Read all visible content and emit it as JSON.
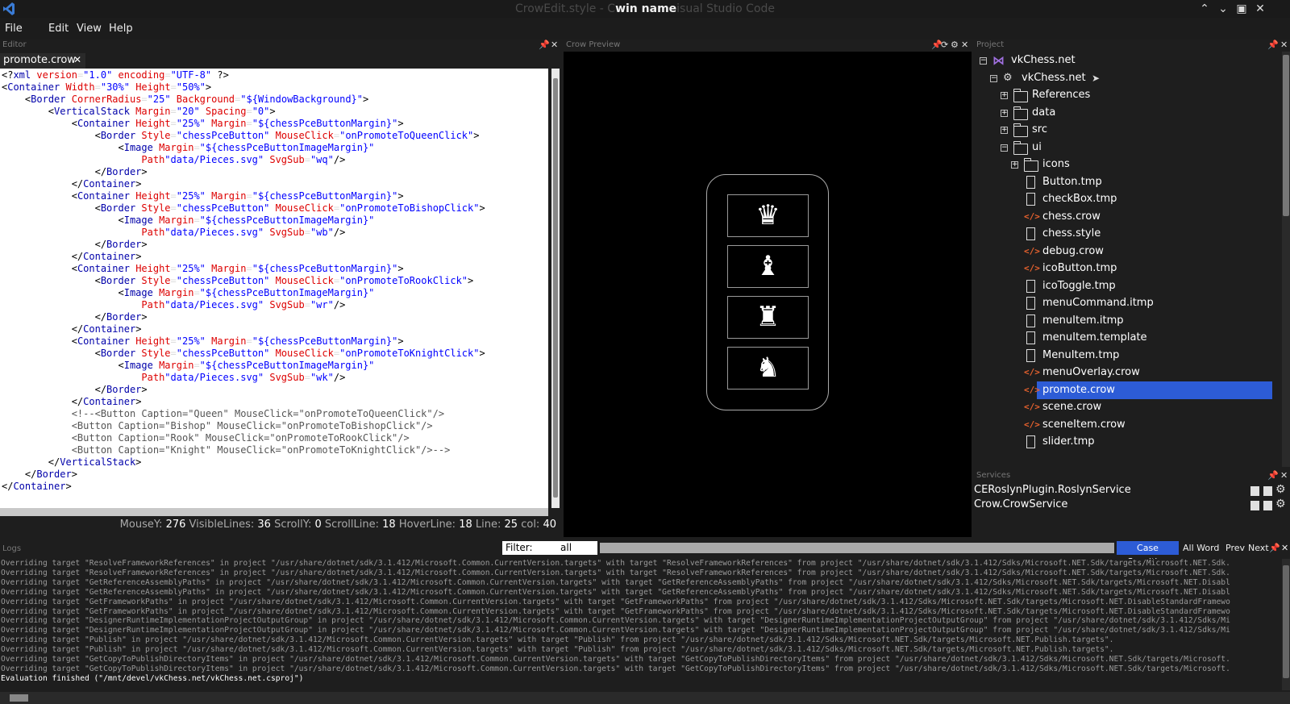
{
  "window": {
    "title_prefix": "CrowEdit.style - C",
    "title_bold": "win name",
    "title_suffix": "isual Studio Code",
    "minimize": "⌃",
    "maximize": "⌄",
    "restore": "▣",
    "close": "✕"
  },
  "menu": {
    "file": "File",
    "edit": "Edit",
    "view": "View",
    "help": "Help"
  },
  "panels": {
    "editor": "Editor",
    "preview": "Crow Preview",
    "project": "Project",
    "services": "Services",
    "logs": "Logs"
  },
  "editor": {
    "tab_label": "promote.crow",
    "tab_close": "✕",
    "lines": [
      "<?xml version=\"1.0\" encoding=\"UTF-8\" ?>",
      "<Container Width=\"30%\" Height=\"50%\">",
      "    <Border CornerRadius=\"25\" Background=\"${WindowBackground}\">",
      "        <VerticalStack Margin=\"20\" Spacing=\"0\">",
      "            <Container Height=\"25%\" Margin=\"${chessPceButtonMargin}\">",
      "                <Border Style=\"chessPceButton\" MouseClick=\"onPromoteToQueenClick\">",
      "                    <Image Margin=\"${chessPceButtonImageMargin}\"",
      "                        Path=\"data/Pieces.svg\" SvgSub=\"wq\"/>",
      "                </Border>",
      "            </Container>",
      "            <Container Height=\"25%\" Margin=\"${chessPceButtonMargin}\">",
      "                <Border Style=\"chessPceButton\" MouseClick=\"onPromoteToBishopClick\">",
      "                    <Image Margin=\"${chessPceButtonImageMargin}\"",
      "                        Path=\"data/Pieces.svg\" SvgSub=\"wb\"/>",
      "                </Border>",
      "            </Container>",
      "            <Container Height=\"25%\" Margin=\"${chessPceButtonMargin}\">",
      "                <Border Style=\"chessPceButton\" MouseClick=\"onPromoteToRookClick\">",
      "                    <Image Margin=\"${chessPceButtonImageMargin}\"",
      "                        Path=\"data/Pieces.svg\" SvgSub=\"wr\"/>",
      "                </Border>",
      "            </Container>",
      "            <Container Height=\"25%\" Margin=\"${chessPceButtonMargin}\">",
      "                <Border Style=\"chessPceButton\" MouseClick=\"onPromoteToKnightClick\">",
      "                    <Image Margin=\"${chessPceButtonImageMargin}\"",
      "                        Path=\"data/Pieces.svg\" SvgSub=\"wk\"/>",
      "                </Border>",
      "            </Container>",
      "            <!--<Button Caption=\"Queen\" MouseClick=\"onPromoteToQueenClick\"/>",
      "            <Button Caption=\"Bishop\" MouseClick=\"onPromoteToBishopClick\"/>",
      "            <Button Caption=\"Rook\" MouseClick=\"onPromoteToRookClick\"/>",
      "            <Button Caption=\"Knight\" MouseClick=\"onPromoteToKnightClick\"/>-->",
      "        </VerticalStack>",
      "    </Border>",
      "</Container>"
    ],
    "status": {
      "mousey_label": "MouseY:",
      "mousey": "276",
      "visible_label": "VisibleLines:",
      "visible": "36",
      "scrolly_label": "ScrollY:",
      "scrolly": "0",
      "scrollline_label": "ScrollLine:",
      "scrollline": "18",
      "hoverline_label": "HoverLine:",
      "hoverline": "18",
      "line_label": "Line:",
      "line": "25",
      "col_label": "col:",
      "col": "40"
    }
  },
  "preview": {
    "pieces": [
      "♛",
      "♝",
      "♜",
      "♞"
    ],
    "piece_names": [
      "queen",
      "bishop",
      "rook",
      "knight"
    ]
  },
  "project": {
    "nodes": [
      {
        "label": "vkChess.net",
        "kind": "solution",
        "depth": 0,
        "expander": "-"
      },
      {
        "label": "vkChess.net",
        "kind": "csproj",
        "depth": 1,
        "expander": "-"
      },
      {
        "label": "References",
        "kind": "folder",
        "depth": 2,
        "expander": "+"
      },
      {
        "label": "data",
        "kind": "folder",
        "depth": 2,
        "expander": "+"
      },
      {
        "label": "src",
        "kind": "folder",
        "depth": 2,
        "expander": "+"
      },
      {
        "label": "ui",
        "kind": "folder-open",
        "depth": 2,
        "expander": "-"
      },
      {
        "label": "icons",
        "kind": "folder",
        "depth": 3,
        "expander": "+"
      },
      {
        "label": "Button.tmp",
        "kind": "file",
        "depth": 3
      },
      {
        "label": "checkBox.tmp",
        "kind": "file",
        "depth": 3
      },
      {
        "label": "chess.crow",
        "kind": "crow",
        "depth": 3
      },
      {
        "label": "chess.style",
        "kind": "file",
        "depth": 3
      },
      {
        "label": "debug.crow",
        "kind": "crow",
        "depth": 3
      },
      {
        "label": "icoButton.tmp",
        "kind": "crow",
        "depth": 3
      },
      {
        "label": "icoToggle.tmp",
        "kind": "file",
        "depth": 3
      },
      {
        "label": "menuCommand.itmp",
        "kind": "file",
        "depth": 3
      },
      {
        "label": "menuItem.itmp",
        "kind": "file",
        "depth": 3
      },
      {
        "label": "menuItem.template",
        "kind": "file",
        "depth": 3
      },
      {
        "label": "MenuItem.tmp",
        "kind": "file",
        "depth": 3
      },
      {
        "label": "menuOverlay.crow",
        "kind": "crow",
        "depth": 3
      },
      {
        "label": "promote.crow",
        "kind": "crow",
        "depth": 3,
        "selected": true
      },
      {
        "label": "scene.crow",
        "kind": "crow",
        "depth": 3
      },
      {
        "label": "sceneItem.crow",
        "kind": "crow",
        "depth": 3
      },
      {
        "label": "slider.tmp",
        "kind": "file",
        "depth": 3
      }
    ]
  },
  "services": [
    {
      "name": "CERoslynPlugin.RoslynService"
    },
    {
      "name": "Crow.CrowService"
    }
  ],
  "logs": {
    "filter_label": "Filter:",
    "filter_value": "all",
    "case_sensitive": "Case Sensitive",
    "all_word": "All Word",
    "prev": "Prev",
    "next": "Next",
    "lines": [
      "Overriding target \"ResolveFrameworkReferences\" in project \"/usr/share/dotnet/sdk/3.1.412/Microsoft.Common.CurrentVersion.targets\" with target \"ResolveFrameworkReferences\" from project \"/usr/share/dotnet/sdk/3.1.412/Sdks/Microsoft.NET.Sdk/targets/Microsoft.NET.Sdk.",
      "Overriding target \"ResolveFrameworkReferences\" in project \"/usr/share/dotnet/sdk/3.1.412/Microsoft.Common.CurrentVersion.targets\" with target \"ResolveFrameworkReferences\" from project \"/usr/share/dotnet/sdk/3.1.412/Sdks/Microsoft.NET.Sdk/targets/Microsoft.NET.Sdk.",
      "Overriding target \"GetReferenceAssemblyPaths\" in project \"/usr/share/dotnet/sdk/3.1.412/Microsoft.Common.CurrentVersion.targets\" with target \"GetReferenceAssemblyPaths\" from project \"/usr/share/dotnet/sdk/3.1.412/Sdks/Microsoft.NET.Sdk/targets/Microsoft.NET.Disabl",
      "Overriding target \"GetReferenceAssemblyPaths\" in project \"/usr/share/dotnet/sdk/3.1.412/Microsoft.Common.CurrentVersion.targets\" with target \"GetReferenceAssemblyPaths\" from project \"/usr/share/dotnet/sdk/3.1.412/Sdks/Microsoft.NET.Sdk/targets/Microsoft.NET.Disabl",
      "Overriding target \"GetFrameworkPaths\" in project \"/usr/share/dotnet/sdk/3.1.412/Microsoft.Common.CurrentVersion.targets\" with target \"GetFrameworkPaths\" from project \"/usr/share/dotnet/sdk/3.1.412/Sdks/Microsoft.NET.Sdk/targets/Microsoft.NET.DisableStandardFramewo",
      "Overriding target \"GetFrameworkPaths\" in project \"/usr/share/dotnet/sdk/3.1.412/Microsoft.Common.CurrentVersion.targets\" with target \"GetFrameworkPaths\" from project \"/usr/share/dotnet/sdk/3.1.412/Sdks/Microsoft.NET.Sdk/targets/Microsoft.NET.DisableStandardFramewo",
      "Overriding target \"DesignerRuntimeImplementationProjectOutputGroup\" in project \"/usr/share/dotnet/sdk/3.1.412/Microsoft.Common.CurrentVersion.targets\" with target \"DesignerRuntimeImplementationProjectOutputGroup\" from project \"/usr/share/dotnet/sdk/3.1.412/Sdks/Mi",
      "Overriding target \"DesignerRuntimeImplementationProjectOutputGroup\" in project \"/usr/share/dotnet/sdk/3.1.412/Microsoft.Common.CurrentVersion.targets\" with target \"DesignerRuntimeImplementationProjectOutputGroup\" from project \"/usr/share/dotnet/sdk/3.1.412/Sdks/Mi",
      "Overriding target \"Publish\" in project \"/usr/share/dotnet/sdk/3.1.412/Microsoft.Common.CurrentVersion.targets\" with target \"Publish\" from project \"/usr/share/dotnet/sdk/3.1.412/Sdks/Microsoft.NET.Sdk/targets/Microsoft.NET.Publish.targets\".",
      "Overriding target \"Publish\" in project \"/usr/share/dotnet/sdk/3.1.412/Microsoft.Common.CurrentVersion.targets\" with target \"Publish\" from project \"/usr/share/dotnet/sdk/3.1.412/Sdks/Microsoft.NET.Sdk/targets/Microsoft.NET.Publish.targets\".",
      "Overriding target \"GetCopyToPublishDirectoryItems\" in project \"/usr/share/dotnet/sdk/3.1.412/Microsoft.Common.CurrentVersion.targets\" with target \"GetCopyToPublishDirectoryItems\" from project \"/usr/share/dotnet/sdk/3.1.412/Sdks/Microsoft.NET.Sdk/targets/Microsoft.",
      "Overriding target \"GetCopyToPublishDirectoryItems\" in project \"/usr/share/dotnet/sdk/3.1.412/Microsoft.Common.CurrentVersion.targets\" with target \"GetCopyToPublishDirectoryItems\" from project \"/usr/share/dotnet/sdk/3.1.412/Sdks/Microsoft.NET.Sdk/targets/Microsoft."
    ],
    "last_line": "Evaluation finished (\"/mnt/devel/vkChess.net/vkChess.net.csproj\")"
  },
  "colors": {
    "accent": "#2d5cd6",
    "crow_icon": "#e8622e",
    "xml_tag": "#0000aa",
    "xml_attr": "#dd0000",
    "xml_value": "#0000ff"
  }
}
